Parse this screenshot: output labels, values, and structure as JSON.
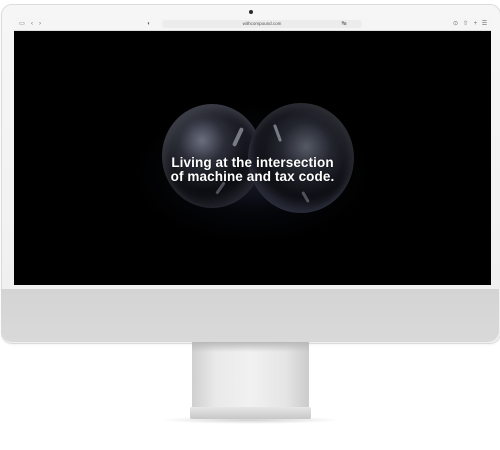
{
  "browser": {
    "url": "withcompound.com",
    "icons": {
      "sidebar": "sidebar-icon",
      "back": "chevron-left-icon",
      "forward": "chevron-right-icon",
      "privacy": "shield-icon",
      "lock": "lock-icon",
      "translate": "translate-icon",
      "download": "download-icon",
      "share": "share-icon",
      "new_tab": "plus-icon",
      "tab_overview": "tabs-grid-icon"
    }
  },
  "hero": {
    "headline_line1": "Living at the intersection",
    "headline_line2": "of machine and tax code."
  },
  "colors": {
    "screen_background": "#000000",
    "headline": "#ffffff",
    "monitor_body": "#f2f2f2",
    "monitor_chin": "#d6d6d6"
  }
}
